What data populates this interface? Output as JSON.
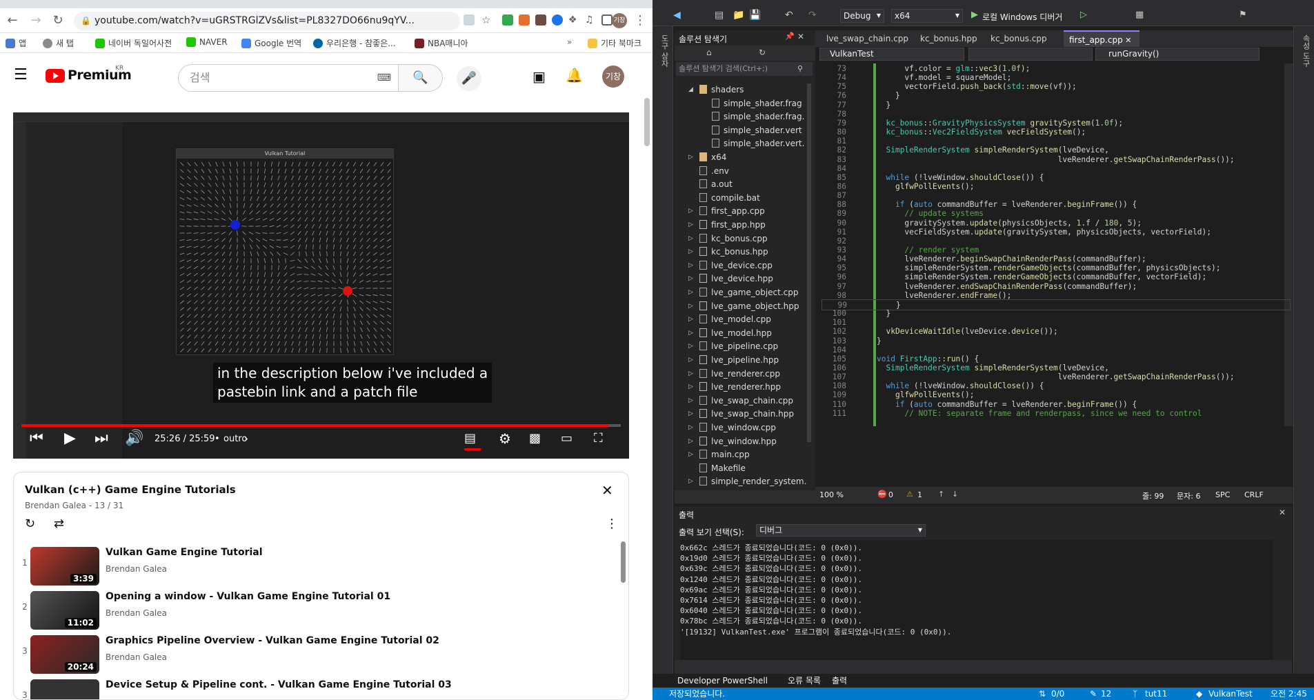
{
  "browser": {
    "url": "youtube.com/watch?v=uGRSTRGlZVs&list=PL8327DO66nu9qYV...",
    "bookmarks": [
      {
        "label": "앱",
        "color": "#4a7bd0"
      },
      {
        "label": "새 탭",
        "color": "#8a8a8a"
      },
      {
        "label": "네이버 독일어사전",
        "color": "#1ec800"
      },
      {
        "label": "NAVER",
        "color": "#1ec800"
      },
      {
        "label": "Google 번역",
        "color": "#4285f4"
      },
      {
        "label": "우리은행 - 참좋은...",
        "color": "#0067ac"
      },
      {
        "label": "NBA매니아",
        "color": "#7a1d2b"
      }
    ],
    "other_bookmarks": "기타 북마크",
    "avatar_text": "기창"
  },
  "youtube": {
    "logo_text": "Premium",
    "region": "KR",
    "search_placeholder": "검색",
    "avatar_text": "기창",
    "video": {
      "caption": "in the description below i've included a\npastebin link and a patch file",
      "time": "25:26 / 25:59",
      "chapter": "outro",
      "progress": 0.979,
      "window_title": "Vulkan Tutorial"
    },
    "playlist": {
      "title": "Vulkan (c++) Game Engine Tutorials",
      "meta": "Brendan Galea - 13 / 31",
      "items": [
        {
          "num": "1",
          "title": "Vulkan Game Engine Tutorial",
          "channel": "Brendan Galea",
          "duration": "3:39"
        },
        {
          "num": "2",
          "title": "Opening a window - Vulkan Game Engine Tutorial 01",
          "channel": "Brendan Galea",
          "duration": "11:02"
        },
        {
          "num": "3",
          "title": "Graphics Pipeline Overview - Vulkan Game Engine Tutorial 02",
          "channel": "Brendan Galea",
          "duration": "20:24"
        },
        {
          "num": "3",
          "title": "Device Setup & Pipeline cont. - Vulkan Game Engine Tutorial 03",
          "channel": "",
          "duration": ""
        }
      ]
    }
  },
  "vs": {
    "config": "Debug",
    "platform": "x64",
    "run_label": "로컬 Windows 디버거",
    "solution_explorer_title": "솔루션 탐색기",
    "solution_search": "솔루션 탐색기 검색(Ctrl+;)",
    "tree": [
      {
        "label": "shaders",
        "indent": 1,
        "kind": "folder"
      },
      {
        "label": "simple_shader.frag",
        "indent": 2,
        "kind": "file"
      },
      {
        "label": "simple_shader.frag.",
        "indent": 2,
        "kind": "file"
      },
      {
        "label": "simple_shader.vert",
        "indent": 2,
        "kind": "file"
      },
      {
        "label": "simple_shader.vert.",
        "indent": 2,
        "kind": "file"
      },
      {
        "label": "x64",
        "indent": 1,
        "kind": "folder"
      },
      {
        "label": ".env",
        "indent": 1,
        "kind": "file"
      },
      {
        "label": "a.out",
        "indent": 1,
        "kind": "file"
      },
      {
        "label": "compile.bat",
        "indent": 1,
        "kind": "file"
      },
      {
        "label": "first_app.cpp",
        "indent": 1,
        "kind": "cpp"
      },
      {
        "label": "first_app.hpp",
        "indent": 1,
        "kind": "hpp"
      },
      {
        "label": "kc_bonus.cpp",
        "indent": 1,
        "kind": "cpp"
      },
      {
        "label": "kc_bonus.hpp",
        "indent": 1,
        "kind": "hpp"
      },
      {
        "label": "lve_device.cpp",
        "indent": 1,
        "kind": "cpp"
      },
      {
        "label": "lve_device.hpp",
        "indent": 1,
        "kind": "hpp"
      },
      {
        "label": "lve_game_object.cpp",
        "indent": 1,
        "kind": "cpp"
      },
      {
        "label": "lve_game_object.hpp",
        "indent": 1,
        "kind": "hpp"
      },
      {
        "label": "lve_model.cpp",
        "indent": 1,
        "kind": "cpp"
      },
      {
        "label": "lve_model.hpp",
        "indent": 1,
        "kind": "hpp"
      },
      {
        "label": "lve_pipeline.cpp",
        "indent": 1,
        "kind": "cpp"
      },
      {
        "label": "lve_pipeline.hpp",
        "indent": 1,
        "kind": "hpp"
      },
      {
        "label": "lve_renderer.cpp",
        "indent": 1,
        "kind": "cpp"
      },
      {
        "label": "lve_renderer.hpp",
        "indent": 1,
        "kind": "hpp"
      },
      {
        "label": "lve_swap_chain.cpp",
        "indent": 1,
        "kind": "cpp"
      },
      {
        "label": "lve_swap_chain.hpp",
        "indent": 1,
        "kind": "hpp"
      },
      {
        "label": "lve_window.cpp",
        "indent": 1,
        "kind": "cpp"
      },
      {
        "label": "lve_window.hpp",
        "indent": 1,
        "kind": "hpp"
      },
      {
        "label": "main.cpp",
        "indent": 1,
        "kind": "cpp"
      },
      {
        "label": "Makefile",
        "indent": 1,
        "kind": "file"
      },
      {
        "label": "simple_render_system.",
        "indent": 1,
        "kind": "cpp"
      },
      {
        "label": "simple_render_system.",
        "indent": 1,
        "kind": "hpp"
      }
    ],
    "tabs": [
      {
        "label": "lve_swap_chain.cpp",
        "active": false
      },
      {
        "label": "kc_bonus.hpp",
        "active": false
      },
      {
        "label": "kc_bonus.cpp",
        "active": false
      },
      {
        "label": "first_app.cpp",
        "active": true
      }
    ],
    "project_dropdown": "VulkanTest",
    "member_dropdown": "runGravity()",
    "code_lines": [
      {
        "n": "73",
        "t": "      vf.color = glm::vec3(1.0f);"
      },
      {
        "n": "74",
        "t": "      vf.model = squareModel;"
      },
      {
        "n": "75",
        "t": "      vectorField.push_back(std::move(vf));"
      },
      {
        "n": "76",
        "t": "    }"
      },
      {
        "n": "77",
        "t": "  }"
      },
      {
        "n": "78",
        "t": ""
      },
      {
        "n": "79",
        "t": "  kc_bonus::GravityPhysicsSystem gravitySystem(1.0f);"
      },
      {
        "n": "80",
        "t": "  kc_bonus::Vec2FieldSystem vecFieldSystem();"
      },
      {
        "n": "81",
        "t": ""
      },
      {
        "n": "82",
        "t": "  SimpleRenderSystem simpleRenderSystem(lveDevice,"
      },
      {
        "n": "83",
        "t": "                                       lveRenderer.getSwapChainRenderPass());"
      },
      {
        "n": "84",
        "t": ""
      },
      {
        "n": "85",
        "t": "  while (!lveWindow.shouldClose()) {"
      },
      {
        "n": "86",
        "t": "    glfwPollEvents();"
      },
      {
        "n": "87",
        "t": ""
      },
      {
        "n": "88",
        "t": "    if (auto commandBuffer = lveRenderer.beginFrame()) {"
      },
      {
        "n": "89",
        "t": "      // update systems"
      },
      {
        "n": "90",
        "t": "      gravitySystem.update(physicsObjects, 1.f / 180, 5);"
      },
      {
        "n": "91",
        "t": "      vecFieldSystem.update(gravitySystem, physicsObjects, vectorField);"
      },
      {
        "n": "92",
        "t": ""
      },
      {
        "n": "93",
        "t": "      // render system"
      },
      {
        "n": "94",
        "t": "      lveRenderer.beginSwapChainRenderPass(commandBuffer);"
      },
      {
        "n": "95",
        "t": "      simpleRenderSystem.renderGameObjects(commandBuffer, physicsObjects);"
      },
      {
        "n": "96",
        "t": "      simpleRenderSystem.renderGameObjects(commandBuffer, vectorField);"
      },
      {
        "n": "97",
        "t": "      lveRenderer.endSwapChainRenderPass(commandBuffer);"
      },
      {
        "n": "98",
        "t": "      lveRenderer.endFrame();"
      },
      {
        "n": "99",
        "t": "    }"
      },
      {
        "n": "100",
        "t": "  }"
      },
      {
        "n": "101",
        "t": ""
      },
      {
        "n": "102",
        "t": "  vkDeviceWaitIdle(lveDevice.device());"
      },
      {
        "n": "103",
        "t": "}"
      },
      {
        "n": "104",
        "t": ""
      },
      {
        "n": "105",
        "t": "void FirstApp::run() {"
      },
      {
        "n": "106",
        "t": "  SimpleRenderSystem simpleRenderSystem(lveDevice,"
      },
      {
        "n": "107",
        "t": "                                       lveRenderer.getSwapChainRenderPass());"
      },
      {
        "n": "108",
        "t": "  while (!lveWindow.shouldClose()) {"
      },
      {
        "n": "109",
        "t": "    glfwPollEvents();"
      },
      {
        "n": "110",
        "t": "    if (auto commandBuffer = lveRenderer.beginFrame()) {"
      },
      {
        "n": "111",
        "t": "      // NOTE: separate frame and renderpass, since we need to control"
      }
    ],
    "zoom": "100 %",
    "errors": "0",
    "warnings": "1",
    "line_info": "줄: 99",
    "col_info": "문자: 6",
    "spc": "SPC",
    "crlf": "CRLF",
    "output_title": "출력",
    "output_source_label": "출력 보기 선택(S):",
    "output_source": "디버그",
    "output_lines": [
      "0x662c 스레드가 종료되었습니다(코드: 0 (0x0)).",
      "0x19d0 스레드가 종료되었습니다(코드: 0 (0x0)).",
      "0x639c 스레드가 종료되었습니다(코드: 0 (0x0)).",
      "0x1240 스레드가 종료되었습니다(코드: 0 (0x0)).",
      "0x69ac 스레드가 종료되었습니다(코드: 0 (0x0)).",
      "0x7614 스레드가 종료되었습니다(코드: 0 (0x0)).",
      "0x6040 스레드가 종료되었습니다(코드: 0 (0x0)).",
      "0x78bc 스레드가 종료되었습니다(코드: 0 (0x0)).",
      "'[19132] VulkanTest.exe' 프로그램이 종료되었습니다(코드: 0 (0x0))."
    ],
    "bottom_tabs": [
      "Developer PowerShell",
      "오류 목록",
      "출력"
    ],
    "status_left": "저장되었습니다.",
    "status_sync": "0/0",
    "status_pencil": "12",
    "status_branch": "tut11",
    "status_repo": "VulkanTest",
    "status_clock": "오전 2:45"
  }
}
